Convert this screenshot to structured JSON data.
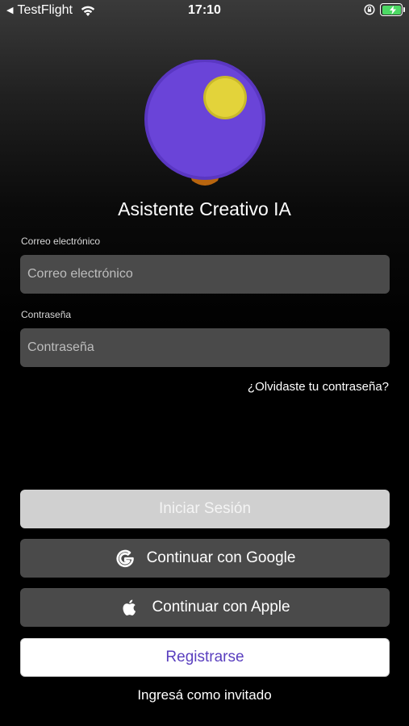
{
  "status_bar": {
    "back_app": "TestFlight",
    "time": "17:10",
    "icons": [
      "back-arrow-icon",
      "wifi-icon",
      "rotation-lock-icon",
      "battery-charging-icon"
    ]
  },
  "app": {
    "title": "Asistente Creativo IA",
    "logo": "lightbulb-icon"
  },
  "form": {
    "email_label": "Correo electrónico",
    "email_placeholder": "Correo electrónico",
    "email_value": "",
    "password_label": "Contraseña",
    "password_placeholder": "Contraseña",
    "password_value": "",
    "forgot_link": "¿Olvidaste tu contraseña?"
  },
  "actions": {
    "login_label": "Iniciar Sesión",
    "google_label": "Continuar con Google",
    "google_icon": "google-icon",
    "apple_label": "Continuar con Apple",
    "apple_icon": "apple-icon",
    "register_label": "Registrarse",
    "guest_label": "Ingresá como invitado"
  },
  "colors": {
    "background": "#000000",
    "input_bg": "#4a4a4a",
    "login_button_bg": "#d0d0d0",
    "register_text": "#5a3fbf",
    "logo_purple": "#6a44d8",
    "logo_yellow": "#e3d33a",
    "logo_orange": "#b8650f",
    "battery_green": "#4cd964"
  }
}
